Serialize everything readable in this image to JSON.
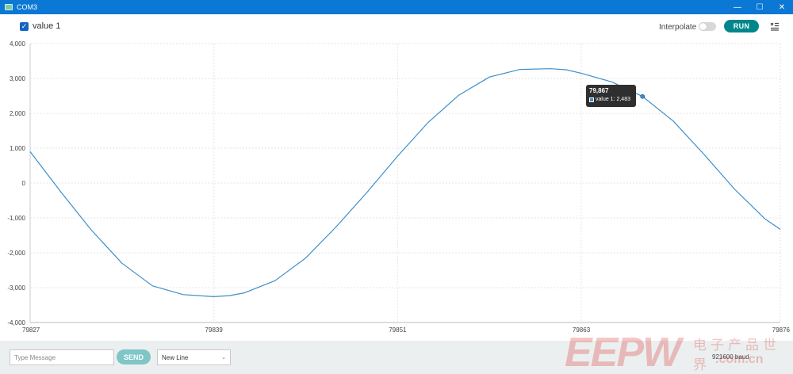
{
  "window": {
    "title": "COM3"
  },
  "toolbar": {
    "series_label": "value 1",
    "interpolate_label": "Interpolate",
    "run_label": "RUN",
    "series_checked": true,
    "interpolate_on": false
  },
  "colors": {
    "accent": "#00868b",
    "series": "#3d8fc9",
    "checkbox": "#1565c0",
    "send": "#7fc6c6",
    "titlebar": "#0a78d4"
  },
  "chart_data": {
    "type": "line",
    "series": [
      {
        "name": "value 1",
        "x": [
          79827,
          79829,
          79831,
          79833,
          79835,
          79837,
          79839,
          79840,
          79841,
          79843,
          79845,
          79847,
          79849,
          79851,
          79853,
          79855,
          79857,
          79859,
          79861,
          79862,
          79863,
          79865,
          79867,
          79869,
          79871,
          79873,
          79875,
          79876
        ],
        "values": [
          900,
          -250,
          -1350,
          -2300,
          -2950,
          -3200,
          -3260,
          -3230,
          -3150,
          -2800,
          -2150,
          -1250,
          -270,
          770,
          1740,
          2520,
          3040,
          3260,
          3280,
          3250,
          3150,
          2900,
          2483,
          1780,
          830,
          -170,
          -1030,
          -1330
        ]
      }
    ],
    "x_ticks": [
      "79827",
      "79839",
      "79851",
      "79863",
      "79876"
    ],
    "y_ticks": [
      "4,000",
      "3,000",
      "2,000",
      "1,000",
      "0",
      "-1,000",
      "-2,000",
      "-3,000",
      "-4,000"
    ],
    "xlim": [
      79827,
      79876
    ],
    "ylim": [
      -4000,
      4000
    ],
    "grid": true,
    "legend": "top-left",
    "tooltip": {
      "x": "79,867",
      "label": "value 1: 2,483",
      "x_value": 79867,
      "y_value": 2483
    }
  },
  "bottom": {
    "message_placeholder": "Type Message",
    "send_label": "SEND",
    "line_ending": "New Line",
    "baud": "921600 baud"
  },
  "watermark": {
    "logo": "EEPW",
    "cn": "电子产品世界",
    "url": ".com.cn"
  },
  "icons": {
    "app": "app-icon",
    "minimize": "minimize-icon",
    "maximize": "maximize-icon",
    "close": "close-icon",
    "clear": "clear-output-icon",
    "dropdown": "chevron-down-icon"
  }
}
